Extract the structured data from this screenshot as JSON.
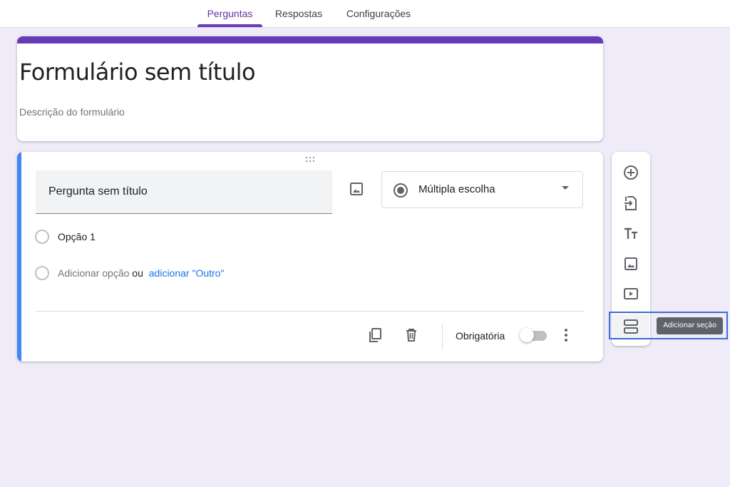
{
  "tabs": [
    {
      "label": "Perguntas",
      "active": true
    },
    {
      "label": "Respostas",
      "active": false
    },
    {
      "label": "Configurações",
      "active": false
    }
  ],
  "form": {
    "title": "Formulário sem título",
    "description_placeholder": "Descrição do formulário"
  },
  "question": {
    "title": "Pergunta sem título",
    "type": "Múltipla escolha",
    "options": [
      {
        "label": "Opção 1"
      }
    ],
    "add_option": "Adicionar opção",
    "add_option_or": "ou",
    "add_other": "adicionar \"Outro\"",
    "required_label": "Obrigatória",
    "required": false
  },
  "side_toolbar": {
    "tools": [
      {
        "name": "add-question",
        "icon": "add-circle-icon"
      },
      {
        "name": "import-questions",
        "icon": "import-icon"
      },
      {
        "name": "add-title",
        "icon": "title-text-icon"
      },
      {
        "name": "add-image",
        "icon": "image-icon"
      },
      {
        "name": "add-video",
        "icon": "video-icon"
      },
      {
        "name": "add-section",
        "icon": "section-icon"
      }
    ],
    "tooltip": "Adicionar seção"
  },
  "colors": {
    "accent": "#673ab7",
    "question_bar": "#4285f4",
    "link": "#1a73e8",
    "background": "#efebf8"
  }
}
